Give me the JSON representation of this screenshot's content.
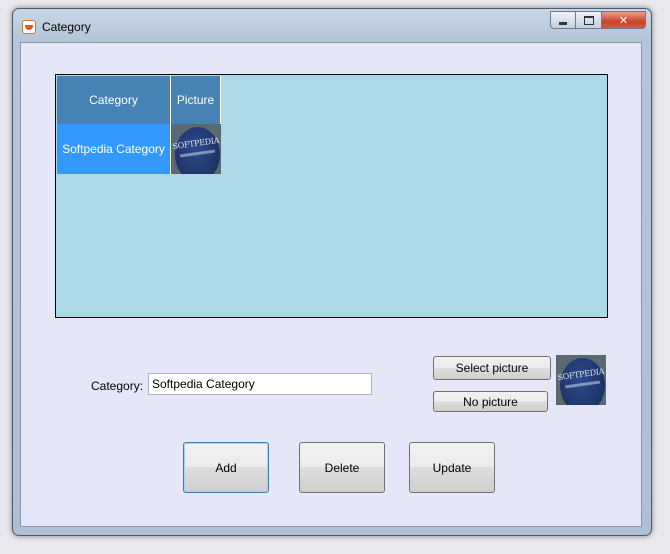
{
  "window": {
    "title": "Category",
    "icon": "app-icon",
    "caption_buttons": {
      "minimize": "minimize-icon",
      "maximize": "maximize-icon",
      "close_glyph": "✕"
    }
  },
  "grid": {
    "columns": [
      "Category",
      "Picture"
    ],
    "rows": [
      {
        "category": "Softpedia Category",
        "picture_text": "SOFTPEDIA"
      }
    ],
    "colors": {
      "background": "#add8e6",
      "header": "#4682b4",
      "selected_row": "#3399ff"
    }
  },
  "form": {
    "category_label": "Category:",
    "category_value": "Softpedia Category",
    "select_picture_label": "Select picture",
    "no_picture_label": "No picture",
    "preview_text": "SOFTPEDIA"
  },
  "actions": {
    "add_label": "Add",
    "delete_label": "Delete",
    "update_label": "Update"
  }
}
